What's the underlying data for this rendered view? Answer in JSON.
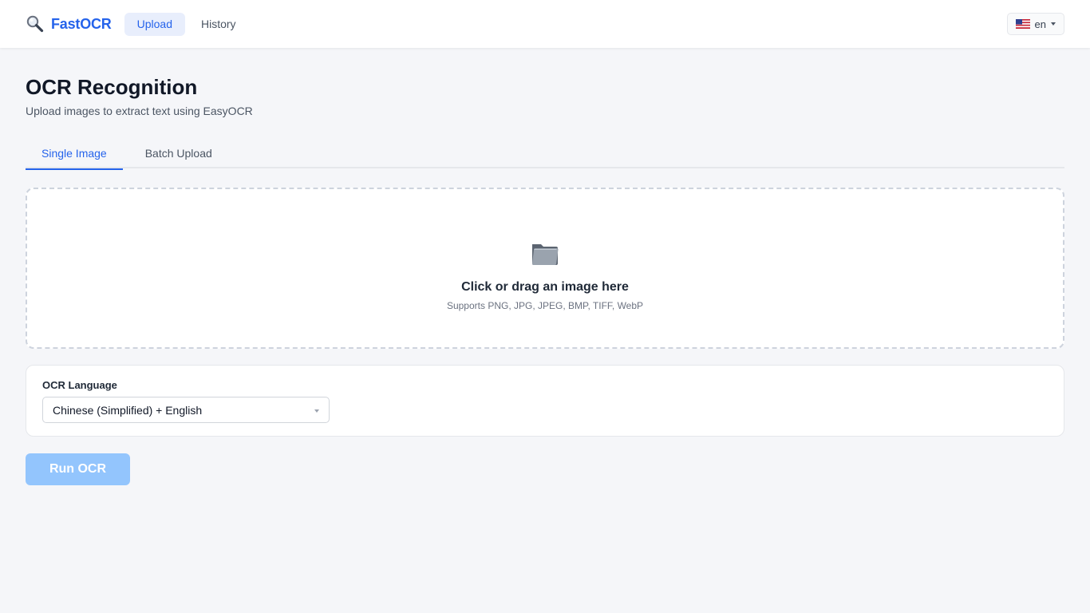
{
  "header": {
    "brand_icon": "magnifier-icon",
    "brand_name": "FastOCR",
    "nav": [
      {
        "label": "Upload",
        "active": true
      },
      {
        "label": "History",
        "active": false
      }
    ],
    "language": {
      "flag_icon": "us-flag-icon",
      "value": "en"
    }
  },
  "page": {
    "title": "OCR Recognition",
    "subtitle": "Upload images to extract text using EasyOCR"
  },
  "tabs": [
    {
      "label": "Single Image",
      "active": true
    },
    {
      "label": "Batch Upload",
      "active": false
    }
  ],
  "dropzone": {
    "icon": "folder-icon",
    "title": "Click or drag an image here",
    "hint": "Supports PNG, JPG, JPEG, BMP, TIFF, WebP"
  },
  "settings": {
    "language_label": "OCR Language",
    "language_value": "Chinese (Simplified) + English"
  },
  "actions": {
    "run_label": "Run OCR",
    "run_disabled": true
  },
  "colors": {
    "accent": "#2563eb",
    "background": "#f5f6f9",
    "button_disabled": "#93c5fd"
  }
}
